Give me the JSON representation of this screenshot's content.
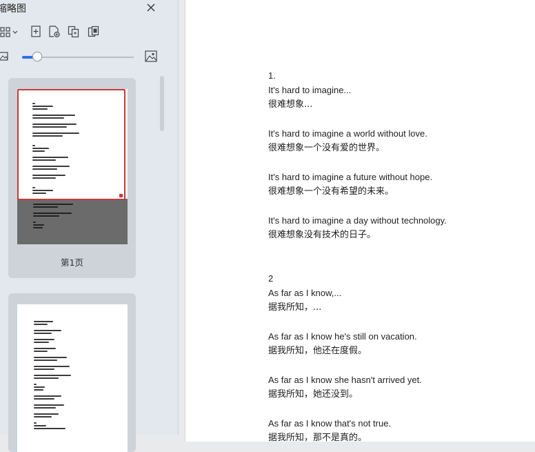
{
  "sidebar": {
    "title": "缩略图",
    "pages": [
      {
        "label": "第1页"
      },
      {
        "label": ""
      }
    ]
  },
  "document": {
    "blocks": [
      {
        "lines": [
          "1.",
          "It's hard to imagine...",
          "很难想象..."
        ]
      },
      {
        "lines": [
          "It's hard to imagine a world without love.",
          "很难想象一个没有爱的世界。"
        ]
      },
      {
        "lines": [
          "It's hard to imagine a future without hope.",
          "很难想象一个没有希望的未来。"
        ]
      },
      {
        "lines": [
          "It's hard to imagine a day without technology.",
          "很难想象没有技术的日子。"
        ]
      },
      {
        "lines": [
          "2",
          "As far as I know,...",
          "据我所知，..."
        ]
      },
      {
        "lines": [
          "As far as I know he's still on vacation.",
          "据我所知，他还在度假。"
        ]
      },
      {
        "lines": [
          "As far as I know she hasn't arrived yet.",
          "据我所知，她还没到。"
        ]
      },
      {
        "lines": [
          "As far as I know that's not true.",
          "据我所知，那不是真的。"
        ]
      }
    ]
  },
  "colors": {
    "accent": "#2f6fe6",
    "selection_frame": "#c43a3a",
    "sidebar_bg": "#e3e8ee"
  },
  "zoom_slider": {
    "level": 0.13
  }
}
